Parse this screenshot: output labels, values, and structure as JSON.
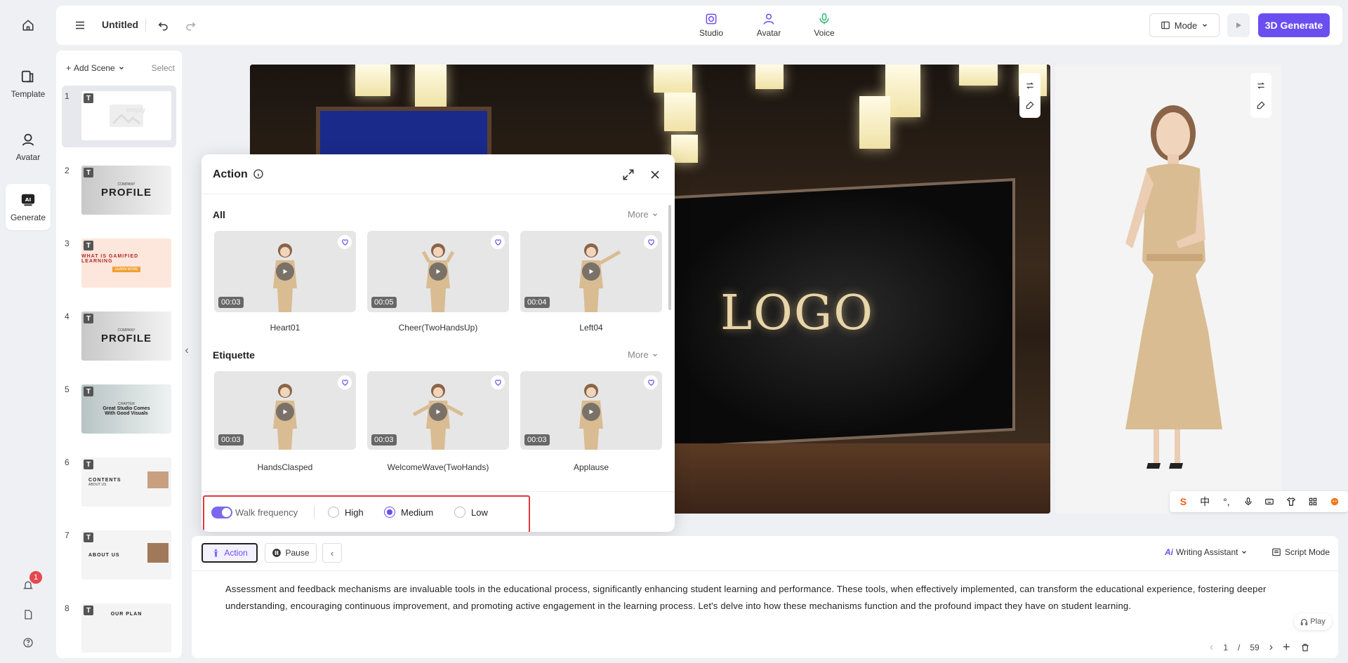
{
  "nav": {
    "items": [
      {
        "label": "Template",
        "icon": "template-icon"
      },
      {
        "label": "Avatar",
        "icon": "avatar-icon"
      },
      {
        "label": "Generate",
        "icon": "ai-generate-icon"
      }
    ],
    "notification_count": "1"
  },
  "topbar": {
    "title": "Untitled",
    "tabs": [
      {
        "label": "Studio",
        "icon": "studio-icon"
      },
      {
        "label": "Avatar",
        "icon": "avatar-icon"
      },
      {
        "label": "Voice",
        "icon": "microphone-icon"
      }
    ],
    "mode_label": "Mode",
    "generate_label": "3D Generate"
  },
  "scenes": {
    "add_label": "Add Scene",
    "select_label": "Select",
    "items": [
      {
        "num": "1",
        "big": "",
        "small": "empty"
      },
      {
        "num": "2",
        "big": "PROFILE",
        "small": "COMPANY"
      },
      {
        "num": "3",
        "big": "WHAT IS GAMIFIED LEARNING",
        "small": "LEARN MORE"
      },
      {
        "num": "4",
        "big": "PROFILE",
        "small": "COMPANY"
      },
      {
        "num": "5",
        "big": "Great Studio Comes With Good Visuals",
        "small": "CHAPTER"
      },
      {
        "num": "6",
        "big": "CONTENTS",
        "small": "ABOUT US"
      },
      {
        "num": "7",
        "big": "ABOUT US",
        "small": ""
      },
      {
        "num": "8",
        "big": "OUR PLAN",
        "small": ""
      }
    ]
  },
  "canvas": {
    "logo_text": "LOGO"
  },
  "action_dialog": {
    "title": "Action",
    "sections": [
      {
        "name": "All",
        "more": "More",
        "cards": [
          {
            "label": "Heart01",
            "duration": "00:03"
          },
          {
            "label": "Cheer(TwoHandsUp)",
            "duration": "00:05"
          },
          {
            "label": "Left04",
            "duration": "00:04"
          }
        ]
      },
      {
        "name": "Etiquette",
        "more": "More",
        "cards": [
          {
            "label": "HandsClasped",
            "duration": "00:03"
          },
          {
            "label": "WelcomeWave(TwoHands)",
            "duration": "00:03"
          },
          {
            "label": "Applause",
            "duration": "00:03"
          }
        ]
      }
    ],
    "walk_frequency": {
      "label": "Walk frequency",
      "enabled": true,
      "options": [
        "High",
        "Medium",
        "Low"
      ],
      "selected": "Medium"
    }
  },
  "script": {
    "action_label": "Action",
    "pause_label": "Pause",
    "writing_assistant_label": "Writing Assistant",
    "script_mode_label": "Script Mode",
    "text": "Assessment and feedback mechanisms are invaluable tools in the educational process, significantly enhancing student learning and performance. These tools, when effectively implemented, can transform the educational experience, fostering deeper understanding, encouraging continuous improvement, and promoting active engagement in the learning process. Let's delve into how these mechanisms function and the profound impact they have on student learning.",
    "play_label": "Play",
    "page_current": "1",
    "page_sep": "/",
    "page_total": "59"
  },
  "ime": {
    "items": [
      "S",
      "中",
      "°,",
      "mic",
      "kbd",
      "shirt",
      "grid",
      "fox"
    ]
  },
  "colors": {
    "accent": "#6b4ef0",
    "highlight_box": "#e0393e",
    "badge": "#e5484d"
  }
}
